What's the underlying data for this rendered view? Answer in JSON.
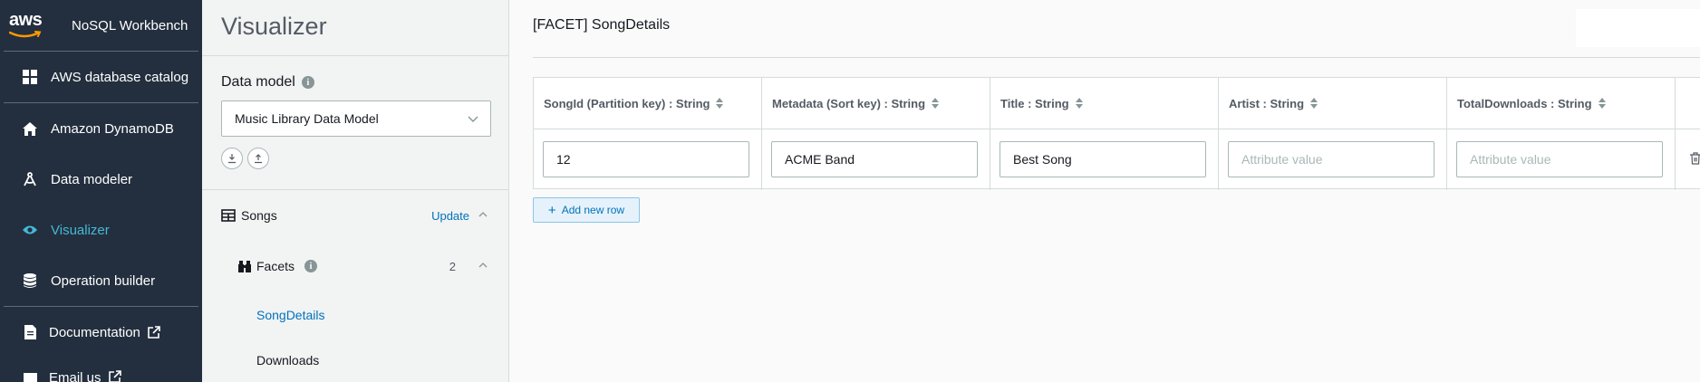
{
  "app": {
    "logo_text": "aws",
    "name": "NoSQL Workbench"
  },
  "sidebar": {
    "items": [
      {
        "label": "AWS database catalog",
        "icon": "grid-icon"
      },
      {
        "label": "Amazon DynamoDB",
        "icon": "home-icon"
      },
      {
        "label": "Data modeler",
        "icon": "compass-icon"
      },
      {
        "label": "Visualizer",
        "icon": "eye-icon",
        "active": true
      },
      {
        "label": "Operation builder",
        "icon": "database-icon"
      },
      {
        "label": "Documentation",
        "icon": "document-icon"
      },
      {
        "label": "Email us",
        "icon": "mail-icon"
      }
    ]
  },
  "panel": {
    "title": "Visualizer",
    "data_model_label": "Data model",
    "data_model_value": "Music Library Data Model",
    "table_name": "Songs",
    "update_label": "Update",
    "facets_label": "Facets",
    "facets_count": "2",
    "facets": [
      "SongDetails",
      "Downloads"
    ],
    "active_facet": "SongDetails"
  },
  "main": {
    "title": "[FACET] SongDetails",
    "columns": [
      "SongId (Partition key) : String",
      "Metadata (Sort key) : String",
      "Title : String",
      "Artist : String",
      "TotalDownloads : String"
    ],
    "row": {
      "values": [
        "12",
        "ACME Band",
        "Best Song",
        "",
        ""
      ],
      "placeholder": "Attribute value"
    },
    "add_row_label": "Add new row"
  },
  "colors": {
    "sidebar_bg": "#232f3e",
    "accent": "#0073bb",
    "active_nav": "#44b9d6"
  }
}
